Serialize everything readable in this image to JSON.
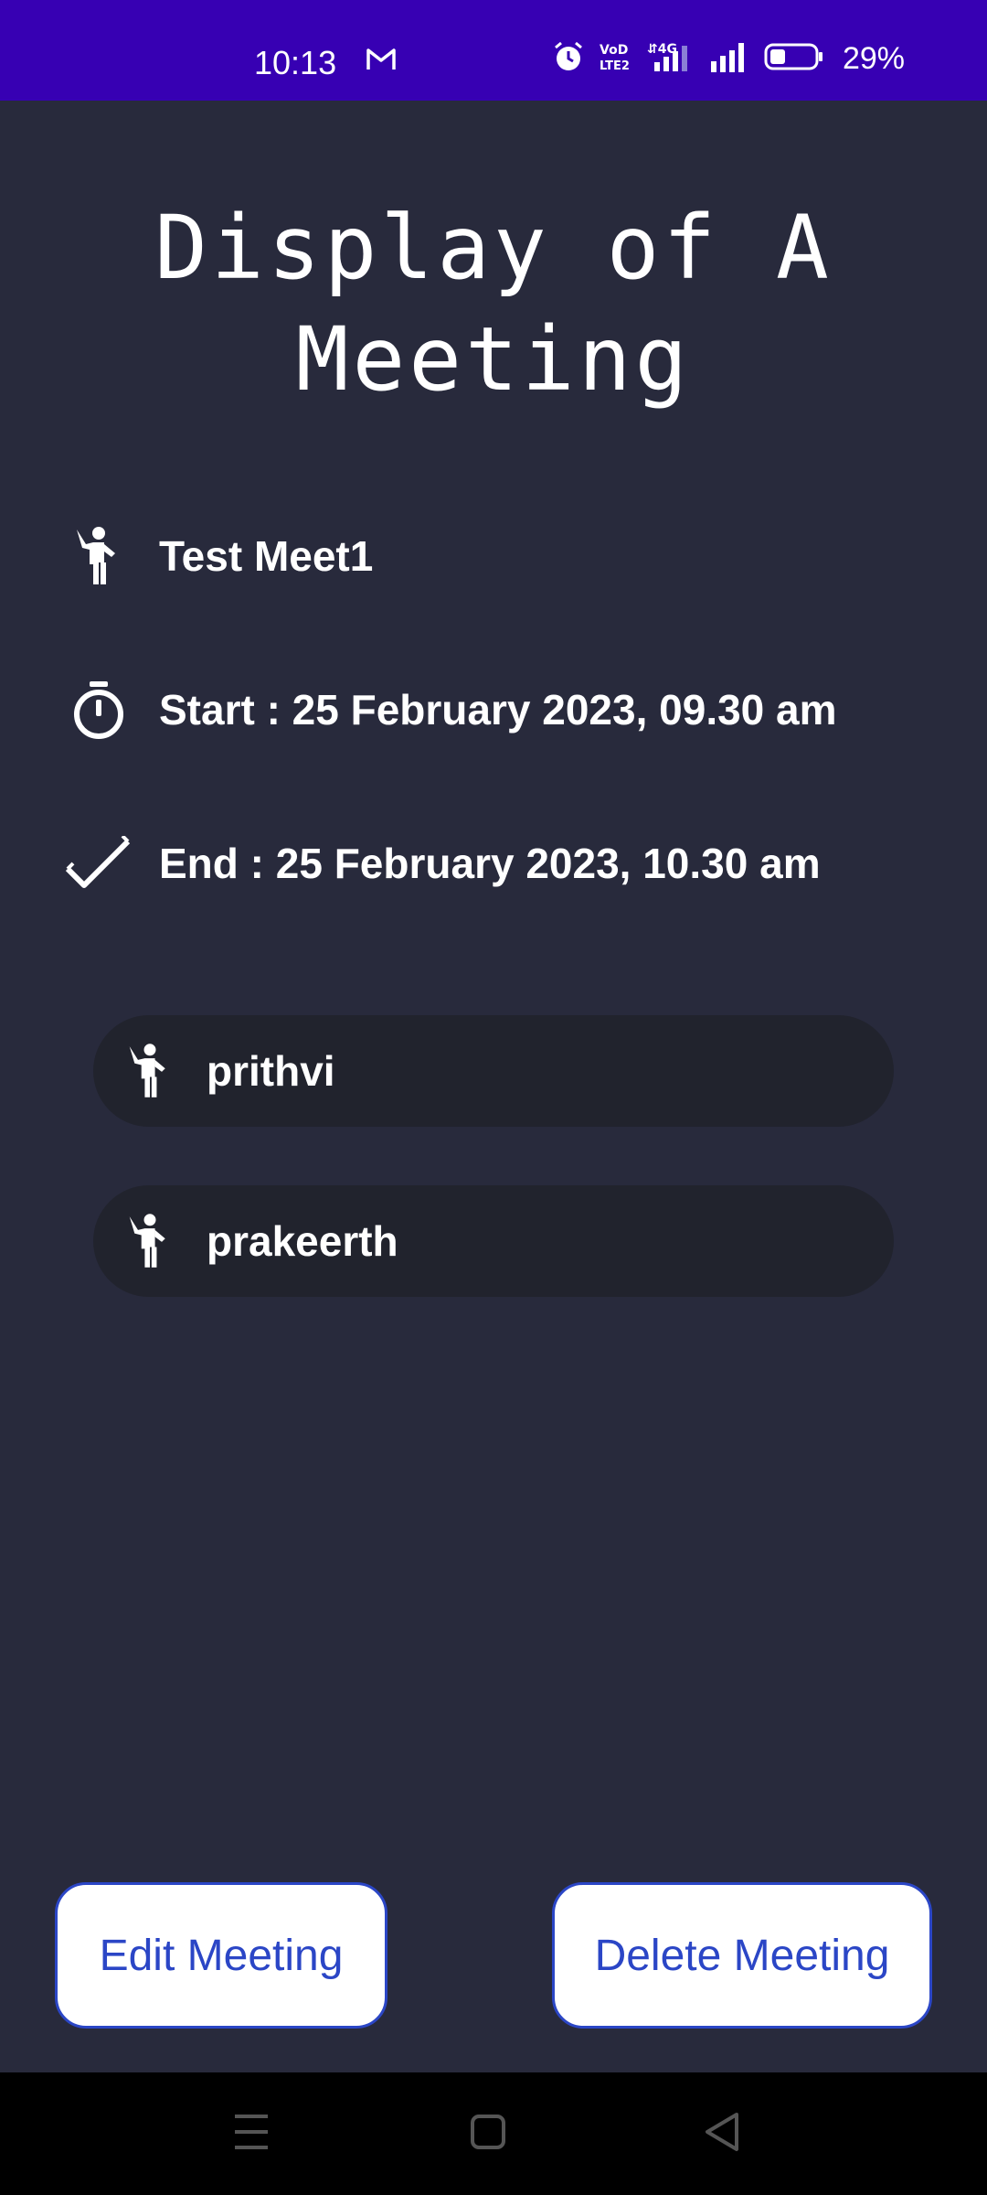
{
  "status_bar": {
    "time": "10:13",
    "battery": "29%",
    "icons": [
      "gmail-icon",
      "alarm-icon",
      "volte-icon",
      "4g-signal-icon",
      "signal-icon",
      "battery-icon"
    ]
  },
  "page": {
    "title_line1": "Display of A",
    "title_line2": "Meeting"
  },
  "meeting": {
    "name": "Test Meet1",
    "start": "Start : 25 February 2023, 09.30 am",
    "end": "End : 25 February 2023, 10.30 am"
  },
  "participants": [
    {
      "name": "prithvi"
    },
    {
      "name": "prakeerth"
    }
  ],
  "actions": {
    "edit_label": "Edit Meeting",
    "delete_label": "Delete Meeting"
  },
  "colors": {
    "status_bar": "#3700b3",
    "background": "#282a3c",
    "chip": "#21232d",
    "button_text": "#2b46c6"
  },
  "nav": {
    "icons": [
      "menu-icon",
      "home-icon",
      "back-icon"
    ]
  }
}
